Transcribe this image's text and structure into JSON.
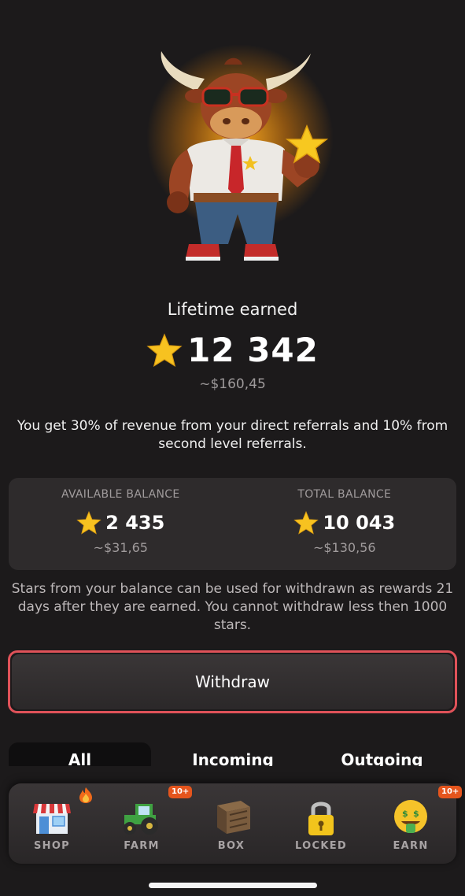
{
  "lifetime": {
    "label": "Lifetime earned",
    "value": "12 342",
    "usd": "~$160,45"
  },
  "info_text": "You get 30% of revenue from your direct referrals and 10% from second level referrals.",
  "balances": [
    {
      "label": "AVAILABLE BALANCE",
      "value": "2 435",
      "usd": "~$31,65"
    },
    {
      "label": "TOTAL BALANCE",
      "value": "10 043",
      "usd": "~$130,56"
    }
  ],
  "withdraw_note": "Stars from your balance can be used for withdrawn as rewards 21 days after they are earned. You cannot withdraw less then 1000 stars.",
  "withdraw_label": "Withdraw",
  "tabs": [
    {
      "label": "All",
      "active": true
    },
    {
      "label": "Incoming",
      "active": false
    },
    {
      "label": "Outgoing",
      "active": false
    }
  ],
  "nav": [
    {
      "label": "SHOP",
      "icon": "shop-icon",
      "badge": "fire-badge"
    },
    {
      "label": "FARM",
      "icon": "tractor-icon",
      "badge": "10+"
    },
    {
      "label": "BOX",
      "icon": "crate-icon"
    },
    {
      "label": "LOCKED",
      "icon": "lock-icon"
    },
    {
      "label": "EARN",
      "icon": "money-face-icon",
      "badge": "10+"
    }
  ],
  "colors": {
    "background": "#1c1a1b",
    "card": "#2e2b2c",
    "accent_outline": "#e05259",
    "badge": "#e5551d",
    "star": "#f7c220"
  }
}
